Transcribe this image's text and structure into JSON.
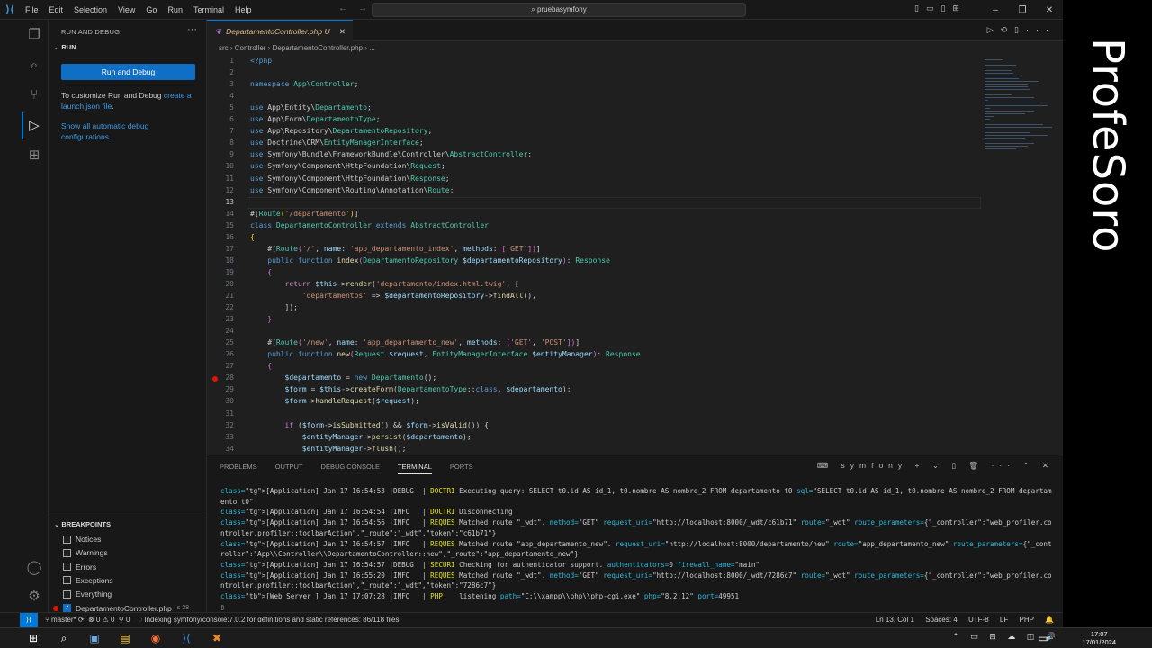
{
  "menu": [
    "File",
    "Edit",
    "Selection",
    "View",
    "Go",
    "Run",
    "Terminal",
    "Help"
  ],
  "window": {
    "search": "pruebasymfony"
  },
  "sidebar": {
    "title": "RUN AND DEBUG",
    "run_section": "RUN",
    "run_button": "Run and Debug",
    "customize_prefix": "To customize Run and Debug ",
    "customize_link": "create a launch.json file",
    "customize_suffix": ".",
    "show_all": "Show all automatic debug configurations.",
    "breakpoints_title": "BREAKPOINTS",
    "breakpoints": [
      {
        "label": "Notices",
        "checked": false
      },
      {
        "label": "Warnings",
        "checked": false
      },
      {
        "label": "Errors",
        "checked": false
      },
      {
        "label": "Exceptions",
        "checked": false
      },
      {
        "label": "Everything",
        "checked": false
      },
      {
        "label": "DepartamentoController.php",
        "checked": true,
        "count": "s 28"
      }
    ]
  },
  "editor": {
    "tab_name": "DepartamentoController.php",
    "tab_status": "U",
    "breadcrumb": [
      "src",
      "Controller",
      "DepartamentoController.php",
      "..."
    ],
    "breakpoint_line": 28,
    "current_line": 13
  },
  "panel": {
    "tabs": [
      "PROBLEMS",
      "OUTPUT",
      "DEBUG CONSOLE",
      "TERMINAL",
      "PORTS"
    ],
    "active_tab": "TERMINAL",
    "shell": "symfony",
    "lines": [
      "[Application] Jan 17 16:54:53 |DEBUG  | DOCTRI Executing query: SELECT t0.id AS id_1, t0.nombre AS nombre_2 FROM departamento t0 sql=\"SELECT t0.id AS id_1, t0.nombre AS nombre_2 FROM departamento t0\"",
      "[Application] Jan 17 16:54:54 |INFO   | DOCTRI Disconnecting",
      "[Application] Jan 17 16:54:56 |INFO   | REQUES Matched route \"_wdt\". method=\"GET\" request_uri=\"http://localhost:8000/_wdt/c61b71\" route=\"_wdt\" route_parameters={\"_controller\":\"web_profiler.controller.profiler::toolbarAction\",\"_route\":\"_wdt\",\"token\":\"c61b71\"}",
      "[Application] Jan 17 16:54:57 |INFO   | REQUES Matched route \"app_departamento_new\". request_uri=\"http://localhost:8000/departamento/new\" route=\"app_departamento_new\" route_parameters={\"_controller\":\"App\\\\Controller\\\\DepartamentoController::new\",\"_route\":\"app_departamento_new\"}",
      "[Application] Jan 17 16:54:57 |DEBUG  | SECURI Checking for authenticator support. authenticators=0 firewall_name=\"main\"",
      "[Application] Jan 17 16:55:20 |INFO   | REQUES Matched route \"_wdt\". method=\"GET\" request_uri=\"http://localhost:8000/_wdt/7286c7\" route=\"_wdt\" route_parameters={\"_controller\":\"web_profiler.controller.profiler::toolbarAction\",\"_route\":\"_wdt\",\"token\":\"7286c7\"}",
      "[Web Server ] Jan 17 17:07:28 |INFO   | PHP    listening path=\"C:\\\\xampp\\\\php\\\\php-cgi.exe\" php=\"8.2.12\" port=49951"
    ]
  },
  "status": {
    "branch": "master*",
    "errors": "0",
    "warnings": "0",
    "ports": "0",
    "indexing": "Indexing symfony/console:7.0.2 for definitions and static references: 86/118 files",
    "position": "Ln 13, Col 1",
    "spaces": "Spaces: 4",
    "encoding": "UTF-8",
    "eol": "LF",
    "language": "PHP"
  },
  "taskbar": {
    "time": "17:07",
    "date": "17/01/2024"
  },
  "overlay_brand": "ProfeSoro",
  "colors": {
    "accent": "#0078d4",
    "run_button": "#0e6fc4",
    "breakpoint": "#e51400"
  }
}
